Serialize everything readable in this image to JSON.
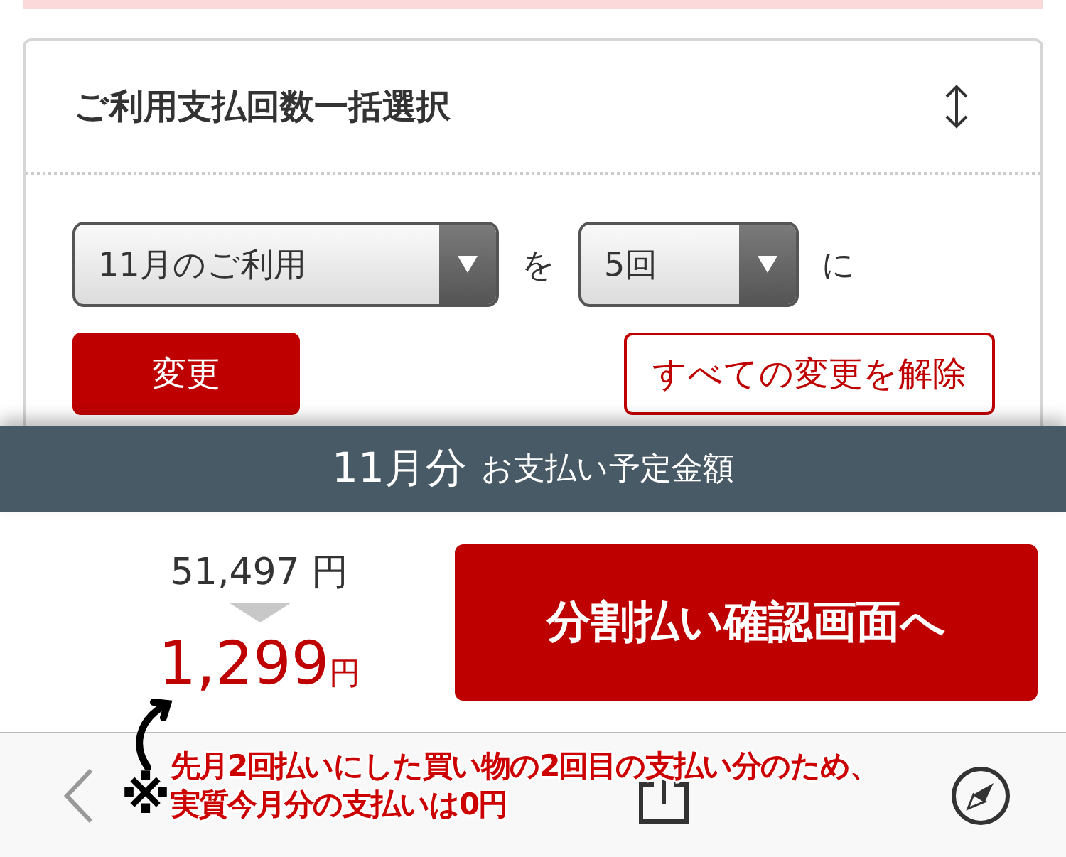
{
  "card": {
    "title": "ご利用支払回数一括選択",
    "month_select": {
      "value": "11月のご利用"
    },
    "connector": "を",
    "count_select": {
      "value": "5回"
    },
    "suffix": "に",
    "change_button": "変更",
    "reset_button": "すべての変更を解除"
  },
  "summary": {
    "month": "11月分",
    "label": "お支払い予定金額",
    "original_amount": "51,497",
    "original_unit": "円",
    "new_amount": "1,299",
    "new_unit": "円",
    "confirm_button": "分割払い確認画面へ"
  },
  "annotation": {
    "mark": "※",
    "lines": [
      "先月2回払いにした買い物の2回目の支払い分のため、",
      "実質今月分の支払いは0円"
    ]
  }
}
